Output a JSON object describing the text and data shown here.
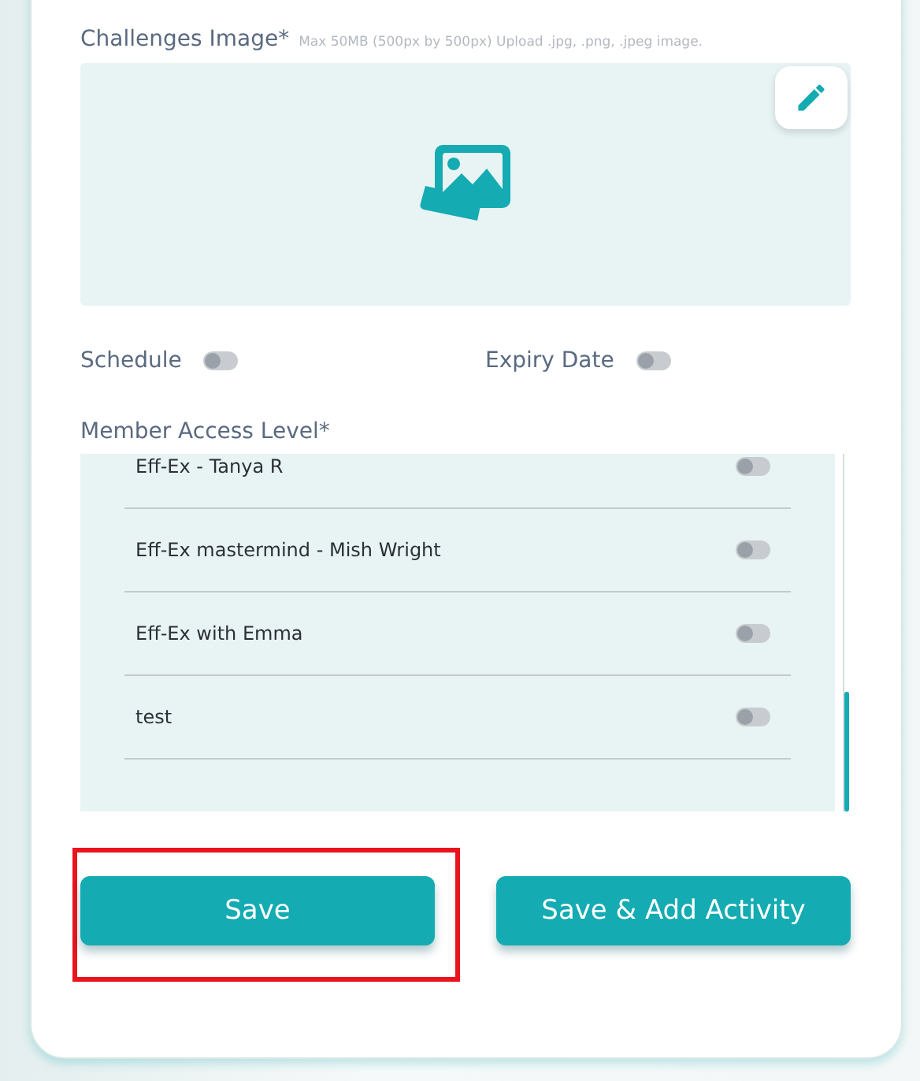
{
  "image_field": {
    "label": "Challenges Image*",
    "hint": "Max 50MB (500px by 500px) Upload .jpg, .png, .jpeg image."
  },
  "toggles": [
    {
      "label": "Schedule",
      "on": false
    },
    {
      "label": "Expiry Date",
      "on": false
    }
  ],
  "access": {
    "label": "Member Access Level*",
    "items": [
      {
        "name": "Eff-Ex - Tanya R",
        "on": false
      },
      {
        "name": "Eff-Ex mastermind - Mish Wright",
        "on": false
      },
      {
        "name": "Eff-Ex with Emma",
        "on": false
      },
      {
        "name": "test",
        "on": false
      }
    ]
  },
  "buttons": [
    {
      "label": "Save",
      "highlighted": true
    },
    {
      "label": "Save & Add Activity",
      "highlighted": false
    }
  ]
}
